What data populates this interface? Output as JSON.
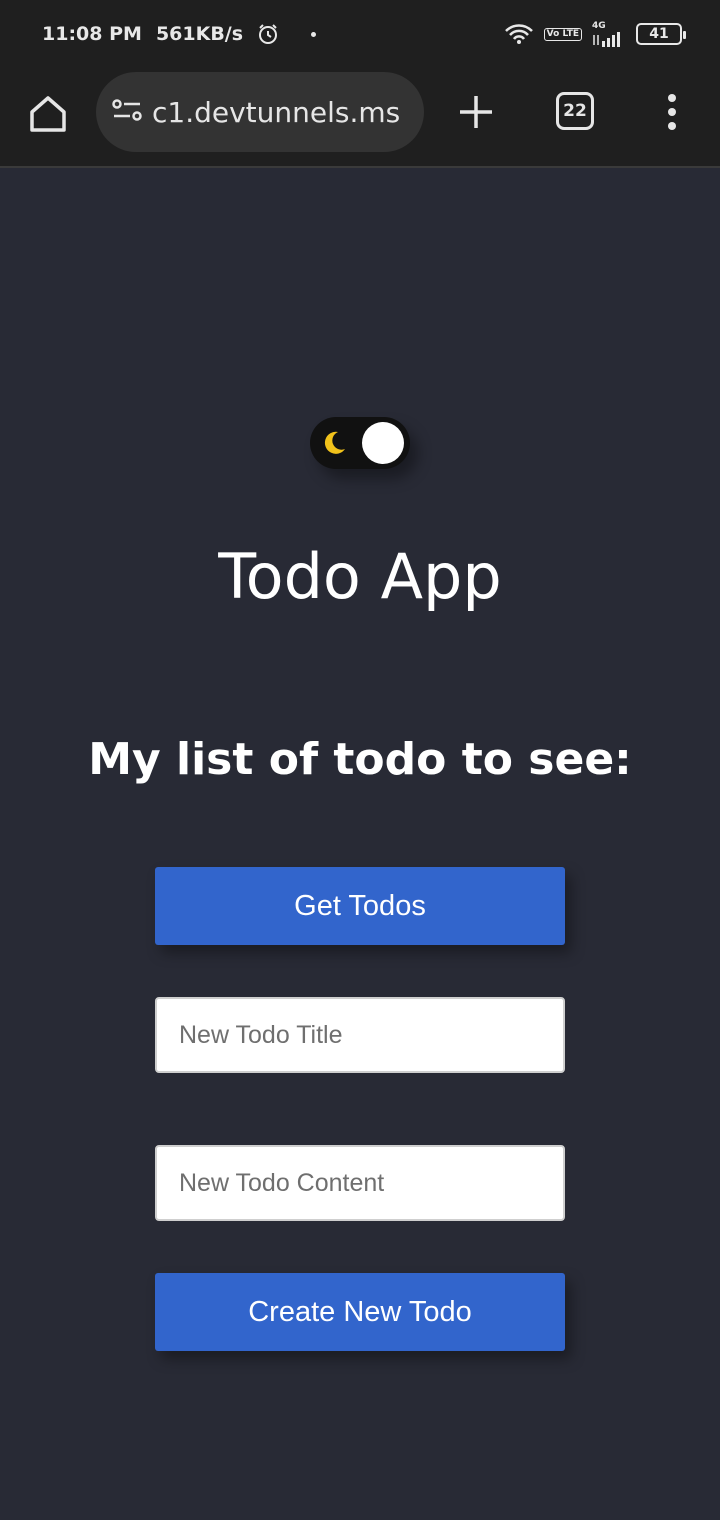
{
  "status_bar": {
    "time": "11:08 PM",
    "speed": "561KB/s",
    "network": "4G",
    "volte": "Vo LTE",
    "battery": "41",
    "icons": [
      "alarm-icon",
      "wifi-icon",
      "volte-icon",
      "signal-icon",
      "battery-icon"
    ]
  },
  "browser": {
    "url": "c1.devtunnels.ms",
    "tab_count": "22",
    "icons": [
      "home-icon",
      "site-settings-icon",
      "new-tab-icon",
      "tabs-icon",
      "menu-icon"
    ]
  },
  "page": {
    "theme_toggle": {
      "state": "dark",
      "icon": "moon-icon",
      "moon_color": "#f1c21b"
    },
    "title": "Todo App",
    "subtitle": "My list of todo to see:",
    "get_button": "Get Todos",
    "title_input": {
      "placeholder": "New Todo Title",
      "value": ""
    },
    "content_input": {
      "placeholder": "New Todo Content",
      "value": ""
    },
    "create_button": "Create New Todo",
    "colors": {
      "background": "#282a35",
      "button": "#3265cc"
    }
  }
}
